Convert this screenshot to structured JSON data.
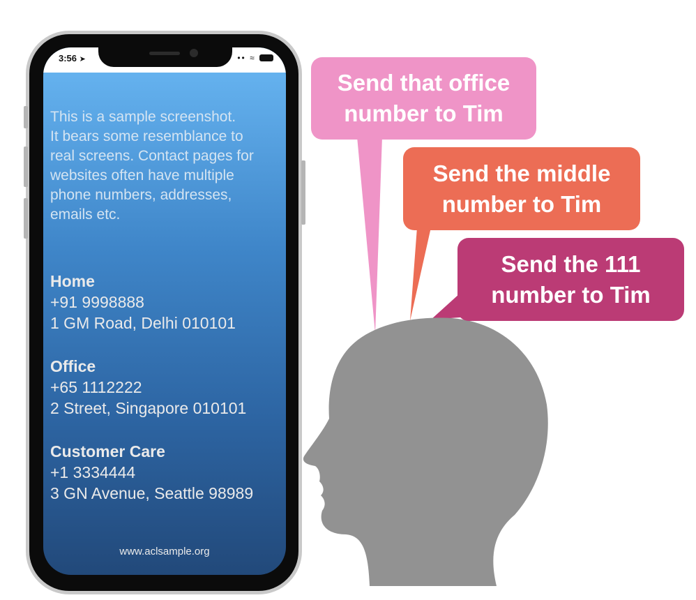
{
  "phone": {
    "status_time": "3:56",
    "intro_text": "This is a sample screenshot.\nIt bears some resemblance to\nreal screens. Contact pages for\nwebsites often have multiple\nphone numbers, addresses,\nemails etc.",
    "contacts": [
      {
        "heading": "Home",
        "phone": "+91 9998888",
        "address": "1 GM Road, Delhi 010101"
      },
      {
        "heading": "Office",
        "phone": "+65 1112222",
        "address": "2 Street, Singapore 010101"
      },
      {
        "heading": "Customer Care",
        "phone": "+1 3334444",
        "address": "3 GN Avenue, Seattle 98989"
      }
    ],
    "footer_url": "www.aclsample.org"
  },
  "bubbles": [
    {
      "line1": "Send that office",
      "line2": "number to Tim",
      "color": "#ef94c7"
    },
    {
      "line1": "Send the middle",
      "line2": "number to Tim",
      "color": "#ec6d55"
    },
    {
      "line1": "Send the 111",
      "line2": "number to Tim",
      "color": "#bb3b75"
    }
  ],
  "colors": {
    "head": "#929292",
    "screen_top": "#6ab8f4",
    "screen_bottom": "#22497a"
  }
}
